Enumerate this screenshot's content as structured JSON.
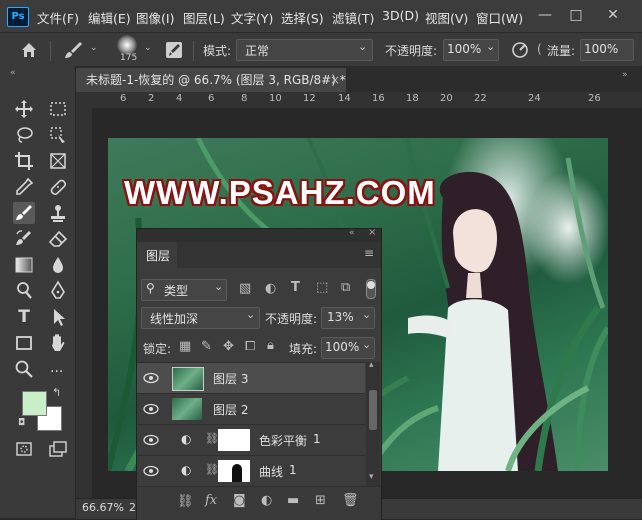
{
  "app": {
    "logo": "Ps"
  },
  "menubar": {
    "items": [
      "文件(F)",
      "编辑(E)",
      "图像(I)",
      "图层(L)",
      "文字(Y)",
      "选择(S)",
      "滤镜(T)",
      "3D(D)",
      "视图(V)",
      "窗口(W)"
    ],
    "window_controls": [
      "—",
      "□",
      "✕"
    ]
  },
  "options_bar": {
    "brush_size": "175",
    "mode_label": "模式:",
    "mode_value": "正常",
    "opacity_label": "不透明度:",
    "opacity_value": "100%",
    "flow_label": "流量:",
    "flow_value": "100%"
  },
  "document": {
    "tab_title": "未标题-1-恢复的 @ 66.7% (图层 3, RGB/8#) *",
    "close_glyph": "×",
    "ruler_numbers": [
      "6",
      "2",
      "4",
      "6",
      "8",
      "10",
      "12",
      "14",
      "16",
      "18",
      "20",
      "22",
      "24",
      "26"
    ],
    "watermark_text": "WWW.PSAHZ.COM",
    "zoom": "66.67%",
    "status_extra": "2"
  },
  "layers_panel": {
    "title": "图层",
    "filter_label": "类型",
    "blend_mode": "线性加深",
    "opacity_label": "不透明度:",
    "opacity_value": "13%",
    "lock_label": "锁定:",
    "fill_label": "填充:",
    "fill_value": "100%",
    "layers": [
      {
        "name": "图层 3",
        "selected": true
      },
      {
        "name": "图层 2",
        "selected": false
      },
      {
        "name": "色彩平衡",
        "number": "1",
        "selected": false
      },
      {
        "name": "曲线",
        "number": "1",
        "selected": false
      }
    ]
  },
  "colors": {
    "foreground": "#c8efc8",
    "background": "#ffffff",
    "accent": "#31a8ff"
  }
}
